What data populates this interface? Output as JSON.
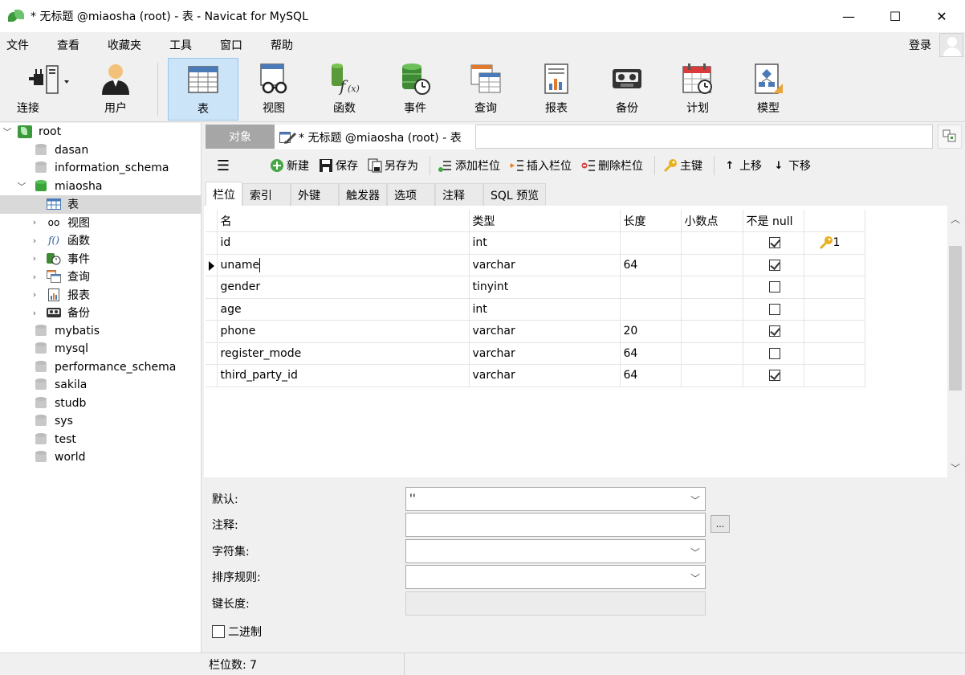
{
  "window": {
    "title": "* 无标题 @miaosha (root) - 表 - Navicat for MySQL",
    "controls": [
      "—",
      "☐",
      "✕"
    ]
  },
  "menu": [
    "文件",
    "查看",
    "收藏夹",
    "工具",
    "窗口",
    "帮助"
  ],
  "login_label": "登录",
  "toolbar": {
    "connect": "连接",
    "user": "用户",
    "table": "表",
    "view": "视图",
    "function": "函数",
    "event": "事件",
    "query": "查询",
    "report": "报表",
    "backup": "备份",
    "schedule": "计划",
    "model": "模型"
  },
  "tree": {
    "root": "root",
    "databases": [
      "dasan",
      "information_schema"
    ],
    "active_db": "miaosha",
    "active_children": [
      "表",
      "视图",
      "函数",
      "事件",
      "查询",
      "报表",
      "备份"
    ],
    "more_databases": [
      "mybatis",
      "mysql",
      "performance_schema",
      "sakila",
      "studb",
      "sys",
      "test",
      "world"
    ]
  },
  "tabs": {
    "objects": "对象",
    "document": "* 无标题 @miaosha (root) - 表"
  },
  "subtoolbar": {
    "new": "新建",
    "save": "保存",
    "save_as": "另存为",
    "add_field": "添加栏位",
    "insert_field": "插入栏位",
    "delete_field": "删除栏位",
    "primary_key": "主键",
    "move_up": "上移",
    "move_down": "下移"
  },
  "inner_tabs": [
    "栏位",
    "索引",
    "外键",
    "触发器",
    "选项",
    "注释",
    "SQL 预览"
  ],
  "grid": {
    "headers": [
      "名",
      "类型",
      "长度",
      "小数点",
      "不是 null",
      ""
    ],
    "rows": [
      {
        "name": "id",
        "type": "int",
        "length": "",
        "decimals": "",
        "not_null": true,
        "key": "1"
      },
      {
        "name": "uname",
        "type": "varchar",
        "length": "64",
        "decimals": "",
        "not_null": true,
        "key": ""
      },
      {
        "name": "gender",
        "type": "tinyint",
        "length": "",
        "decimals": "",
        "not_null": false,
        "key": ""
      },
      {
        "name": "age",
        "type": "int",
        "length": "",
        "decimals": "",
        "not_null": false,
        "key": ""
      },
      {
        "name": "phone",
        "type": "varchar",
        "length": "20",
        "decimals": "",
        "not_null": true,
        "key": ""
      },
      {
        "name": "register_mode",
        "type": "varchar",
        "length": "64",
        "decimals": "",
        "not_null": false,
        "key": ""
      },
      {
        "name": "third_party_id",
        "type": "varchar",
        "length": "64",
        "decimals": "",
        "not_null": true,
        "key": ""
      }
    ]
  },
  "properties": {
    "default_label": "默认:",
    "default_value": "''",
    "comment_label": "注释:",
    "comment_value": "",
    "ellipsis": "...",
    "charset_label": "字符集:",
    "collation_label": "排序规则:",
    "keylen_label": "键长度:",
    "binary_label": "二进制"
  },
  "status": {
    "field_count": "栏位数: 7"
  },
  "colors": {
    "active_tab_bg": "#cce4f7",
    "tree_selected": "#d9d9d9",
    "obj_tab_bg": "#a6a6a6"
  }
}
